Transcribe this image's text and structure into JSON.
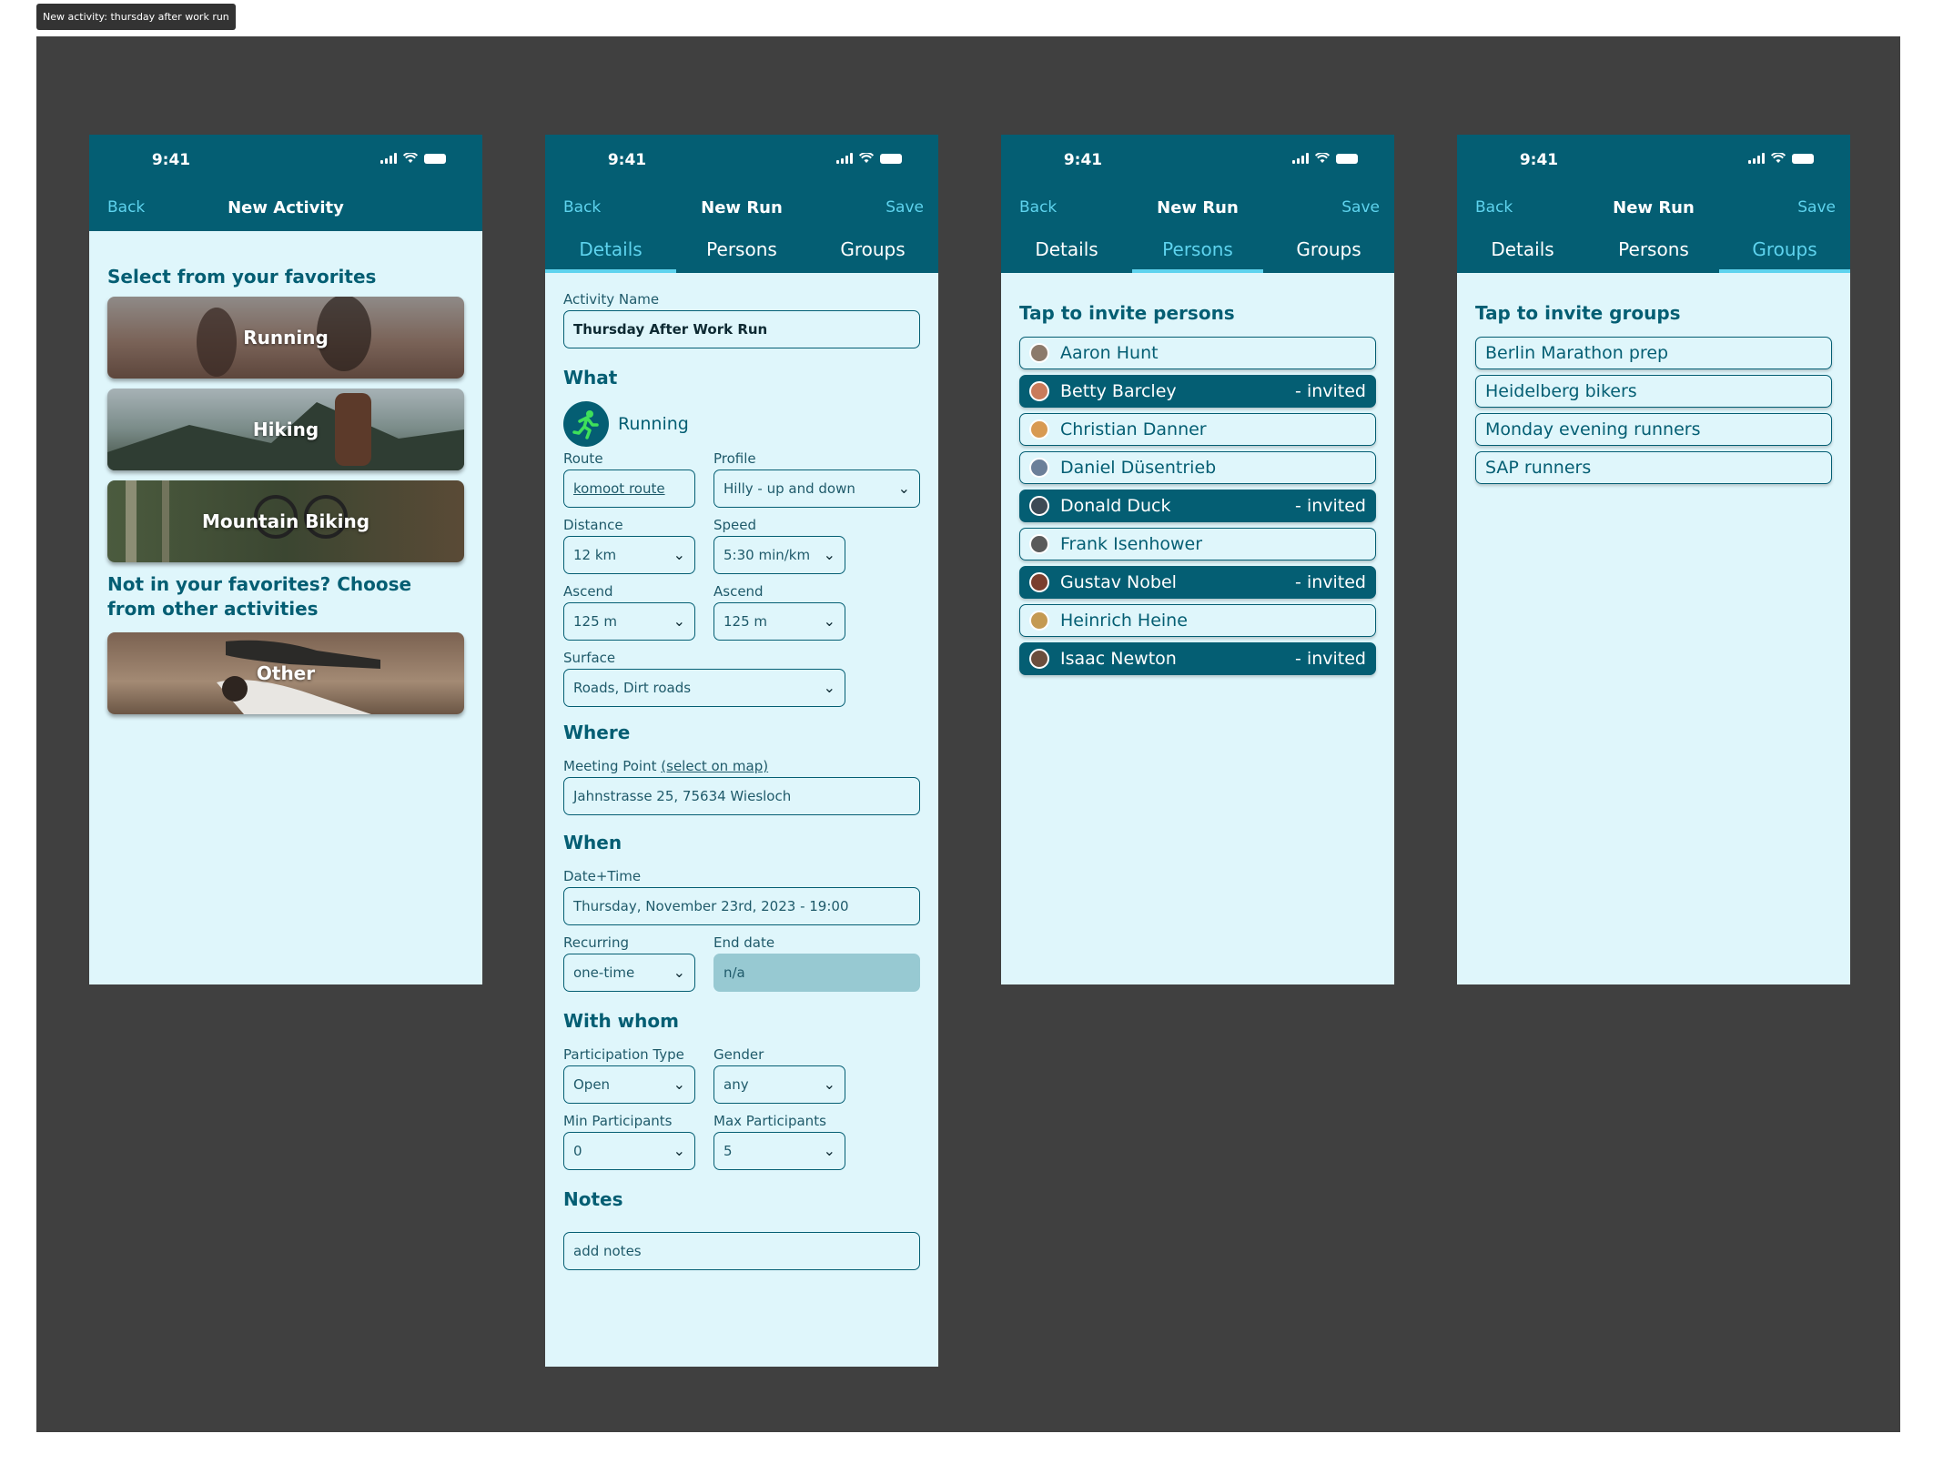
{
  "frame_label": "New activity: thursday after work run",
  "status_time": "9:41",
  "screen1": {
    "nav": {
      "back": "Back",
      "title": "New Activity"
    },
    "favorites_heading": "Select from your favorites",
    "favorites": [
      "Running",
      "Hiking",
      "Mountain Biking"
    ],
    "other_heading": "Not in your favorites? Choose from other activities",
    "other_card": "Other"
  },
  "screen2": {
    "nav": {
      "back": "Back",
      "title": "New Run",
      "save": "Save"
    },
    "tabs": [
      "Details",
      "Persons",
      "Groups"
    ],
    "activity_name_label": "Activity Name",
    "activity_name_value": "Thursday After Work Run",
    "what_heading": "What",
    "activity_type": "Running",
    "route_label": "Route",
    "route_value": "komoot route",
    "profile_label": "Profile",
    "profile_value": "Hilly - up and down",
    "distance_label": "Distance",
    "distance_value": "12 km",
    "speed_label": "Speed",
    "speed_value": "5:30 min/km",
    "ascend1_label": "Ascend",
    "ascend1_value": "125 m",
    "ascend2_label": "Ascend",
    "ascend2_value": "125 m",
    "surface_label": "Surface",
    "surface_value": "Roads, Dirt roads",
    "where_heading": "Where",
    "meeting_label": "Meeting Point",
    "meeting_link": "(select on map)",
    "meeting_value": "Jahnstrasse 25, 75634 Wiesloch",
    "when_heading": "When",
    "datetime_label": "Date+Time",
    "datetime_value": "Thursday, November 23rd, 2023 - 19:00",
    "recurring_label": "Recurring",
    "recurring_value": "one-time",
    "enddate_label": "End date",
    "enddate_value": "n/a",
    "withwhom_heading": "With whom",
    "participation_label": "Participation Type",
    "participation_value": "Open",
    "gender_label": "Gender",
    "gender_value": "any",
    "min_label": "Min Participants",
    "min_value": "0",
    "max_label": "Max Participants",
    "max_value": "5",
    "notes_heading": "Notes",
    "notes_placeholder": "add notes"
  },
  "screen3": {
    "nav": {
      "back": "Back",
      "title": "New Run",
      "save": "Save"
    },
    "tabs": [
      "Details",
      "Persons",
      "Groups"
    ],
    "heading": "Tap to invite persons",
    "invited_suffix": "- invited",
    "persons": [
      {
        "name": "Aaron Hunt",
        "invited": false
      },
      {
        "name": "Betty Barcley",
        "invited": true
      },
      {
        "name": "Christian Danner",
        "invited": false
      },
      {
        "name": "Daniel Düsentrieb",
        "invited": false
      },
      {
        "name": "Donald Duck",
        "invited": true
      },
      {
        "name": "Frank Isenhower",
        "invited": false
      },
      {
        "name": "Gustav Nobel",
        "invited": true
      },
      {
        "name": "Heinrich Heine",
        "invited": false
      },
      {
        "name": "Isaac Newton",
        "invited": true
      }
    ]
  },
  "screen4": {
    "nav": {
      "back": "Back",
      "title": "New Run",
      "save": "Save"
    },
    "tabs": [
      "Details",
      "Persons",
      "Groups"
    ],
    "heading": "Tap to invite groups",
    "groups": [
      "Berlin Marathon prep",
      "Heidelberg bikers",
      "Monday evening runners",
      "SAP runners"
    ]
  },
  "colors": {
    "primary": "#045e73",
    "accent": "#5ed3ee",
    "background": "#dff6fb",
    "canvas": "#404040"
  }
}
